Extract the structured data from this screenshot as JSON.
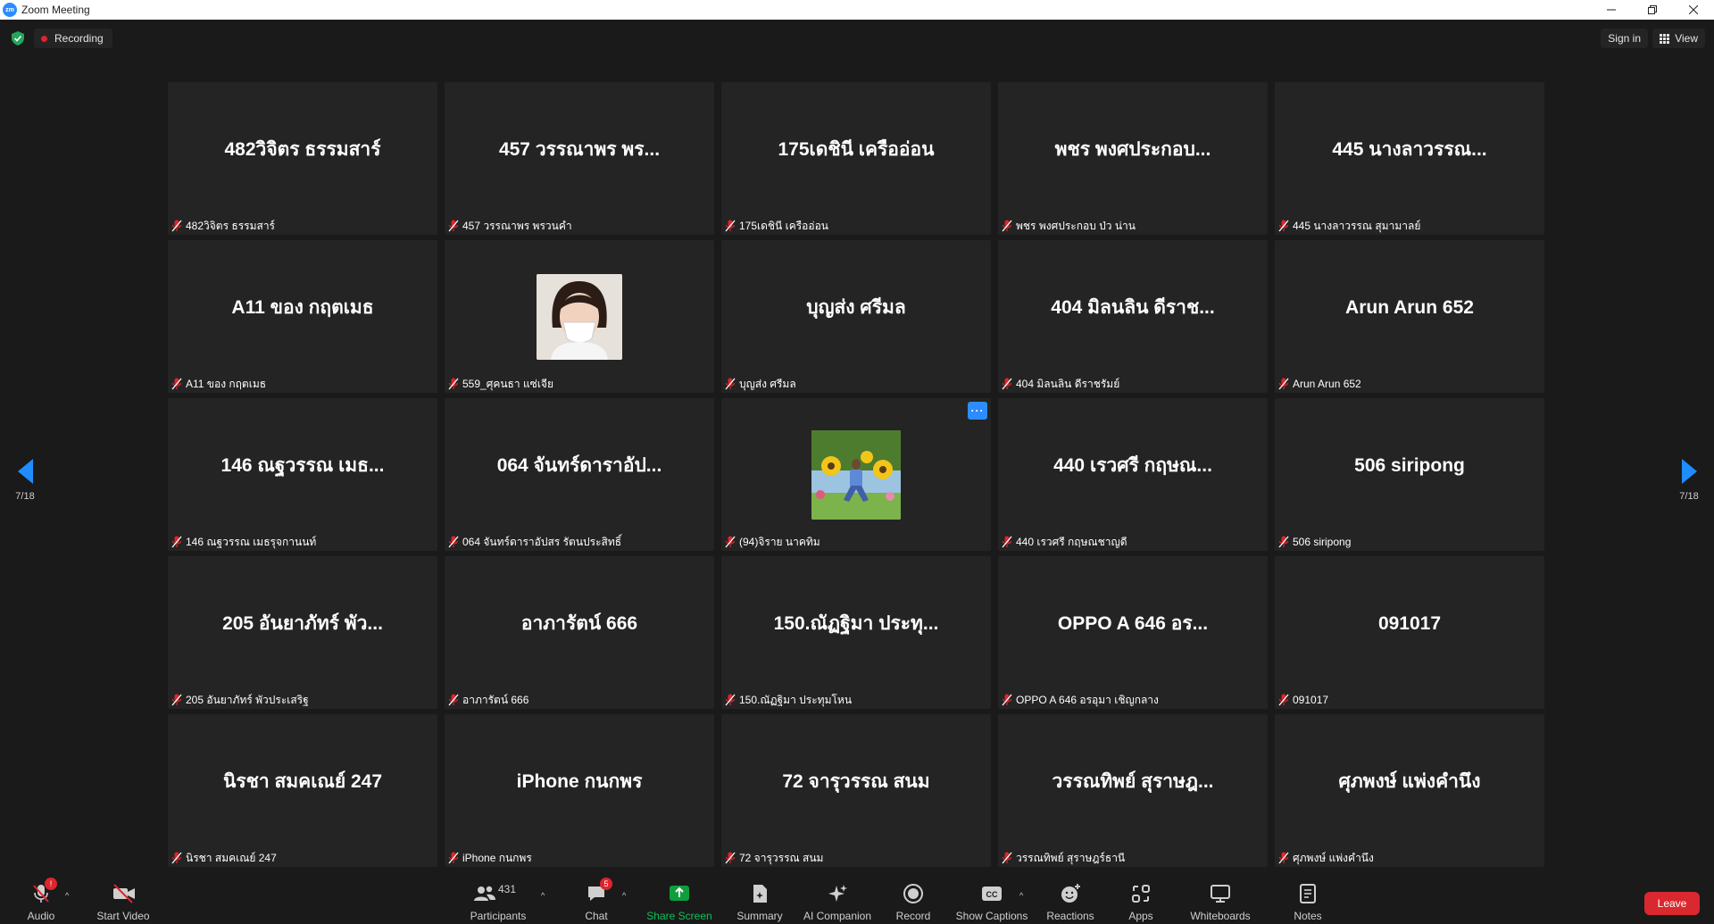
{
  "window": {
    "title": "Zoom Meeting",
    "logo_text": "zm"
  },
  "topbar": {
    "recording_label": "Recording",
    "sign_in_label": "Sign in",
    "view_label": "View"
  },
  "pager": {
    "left": "7/18",
    "right": "7/18"
  },
  "tiles": [
    {
      "display": "482วิจิตร  ธรรมสาร์",
      "label": "482วิจิตร  ธรรมสาร์"
    },
    {
      "display": "457 วรรณาพร พร...",
      "label": "457 วรรณาพร พรวนคำ"
    },
    {
      "display": "175เดชินี เครืออ่อน",
      "label": "175เดชินี เครืออ่อน"
    },
    {
      "display": "พชร พงศประกอบ...",
      "label": "พชร พงศประกอบ ป่ว น่าน"
    },
    {
      "display": "445 นางลาวรรณ...",
      "label": "445 นางลาวรรณ สุมามาลย์"
    },
    {
      "display": "A11 ของ กฤตเมธ",
      "label": "A11 ของ กฤตเมธ"
    },
    {
      "display": "",
      "label": "559_ศุคนธา แซ่เจีย"
    },
    {
      "display": "บุญส่ง ศรีมล",
      "label": "บุญส่ง ศรีมล"
    },
    {
      "display": "404 มิลนลิน ดีราช...",
      "label": "404 มิลนลิน ดีราชรัมย์"
    },
    {
      "display": "Arun Arun 652",
      "label": "Arun Arun 652"
    },
    {
      "display": "146 ณฐวรรณ เมธ...",
      "label": "146 ณฐวรรณ เมธรุจกานนท์"
    },
    {
      "display": "064 จันทร์ดาราอัป...",
      "label": "064 จันทร์ดาราอัปสร รัตนประสิทธิ์"
    },
    {
      "display": "",
      "label": "(94)จิราย  นาคทิม"
    },
    {
      "display": "440 เรวศรี กฤษณ...",
      "label": "440 เรวศรี กฤษณชาญดี"
    },
    {
      "display": "506 siripong",
      "label": "506 siripong"
    },
    {
      "display": "205 อันยาภัทร์ พัว...",
      "label": "205 อันยาภัทร์ พัวประเสริฐ"
    },
    {
      "display": "อาภารัตน์ 666",
      "label": "อาภารัตน์ 666"
    },
    {
      "display": "150.ณัฏฐิมา ประทุ...",
      "label": "150.ณัฏฐิมา ประทุมโหน"
    },
    {
      "display": "OPPO A  646  อร...",
      "label": "OPPO A  646  อรอุมา  เชิญกลาง"
    },
    {
      "display": "091017",
      "label": "091017"
    },
    {
      "display": "นิรชา สมคเณย์ 247",
      "label": "นิรชา สมคเณย์ 247"
    },
    {
      "display": "iPhone กนกพร",
      "label": "iPhone กนกพร"
    },
    {
      "display": "72 จารุวรรณ สนม",
      "label": "72 จารุวรรณ สนม"
    },
    {
      "display": "วรรณทิพย์ สุราษฎ...",
      "label": "วรรณทิพย์ สุราษฎร์ธานี"
    },
    {
      "display": "ศุภพงษ์ แพ่งคำนึง",
      "label": "ศุภพงษ์ แพ่งคำนึง"
    }
  ],
  "toolbar": {
    "audio": "Audio",
    "audio_badge": "!",
    "start_video": "Start Video",
    "participants": "Participants",
    "participants_count": "431",
    "chat": "Chat",
    "chat_badge": "5",
    "share_screen": "Share Screen",
    "summary": "Summary",
    "ai_companion": "AI Companion",
    "record": "Record",
    "show_captions": "Show Captions",
    "cc": "CC",
    "reactions": "Reactions",
    "apps": "Apps",
    "whiteboards": "Whiteboards",
    "notes": "Notes",
    "leave": "Leave"
  },
  "colors": {
    "accent": "#2d8cff",
    "tile_bg": "#242424",
    "leave_red": "#d9282f",
    "share_green": "#0e9f3d",
    "mute_red": "#e0242b"
  }
}
